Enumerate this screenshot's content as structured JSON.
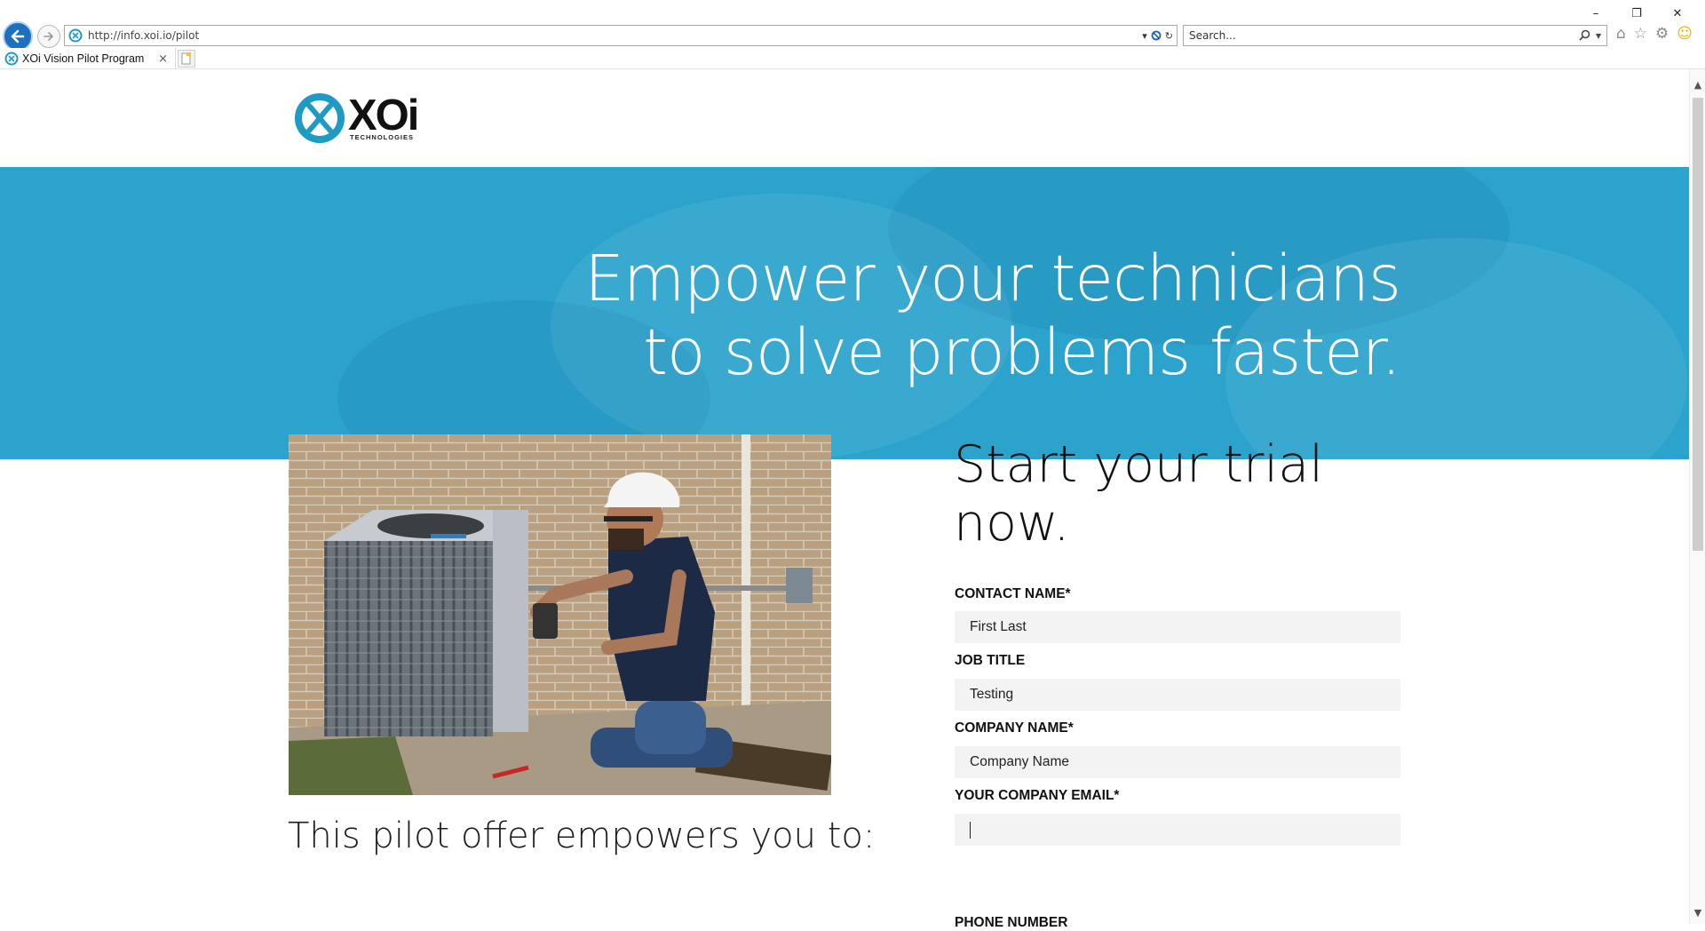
{
  "browser": {
    "address": "http://info.xoi.io/pilot",
    "search_placeholder": "Search...",
    "tab_title": "XOi Vision Pilot Program",
    "tab_close": "×",
    "window": {
      "minimize": "–",
      "restore": "❐",
      "close": "✕"
    },
    "icons": [
      "home-icon",
      "favorites-star-icon",
      "settings-gear-icon",
      "smiley-feedback-icon"
    ]
  },
  "page": {
    "logo": {
      "word": "XOi",
      "sub": "TECHNOLOGIES"
    },
    "hero": {
      "line1": "Empower your technicians",
      "line2": "to solve problems faster."
    },
    "pilot_heading": "This pilot offer empowers you to:",
    "form": {
      "title_line1": "Start your trial",
      "title_line2": "now.",
      "fields": [
        {
          "label": "CONTACT NAME*",
          "value": "First Last"
        },
        {
          "label": "JOB TITLE",
          "value": "Testing"
        },
        {
          "label": "COMPANY NAME*",
          "value": "Company Name"
        },
        {
          "label": "YOUR COMPANY EMAIL*",
          "value": ""
        },
        {
          "label": "PHONE NUMBER",
          "value": ""
        }
      ]
    }
  },
  "colors": {
    "hero_bg": "#2ba3cd",
    "brand_teal": "#1f9ac4",
    "input_bg": "#f3f3f3",
    "back_button": "#1d6fbf"
  }
}
